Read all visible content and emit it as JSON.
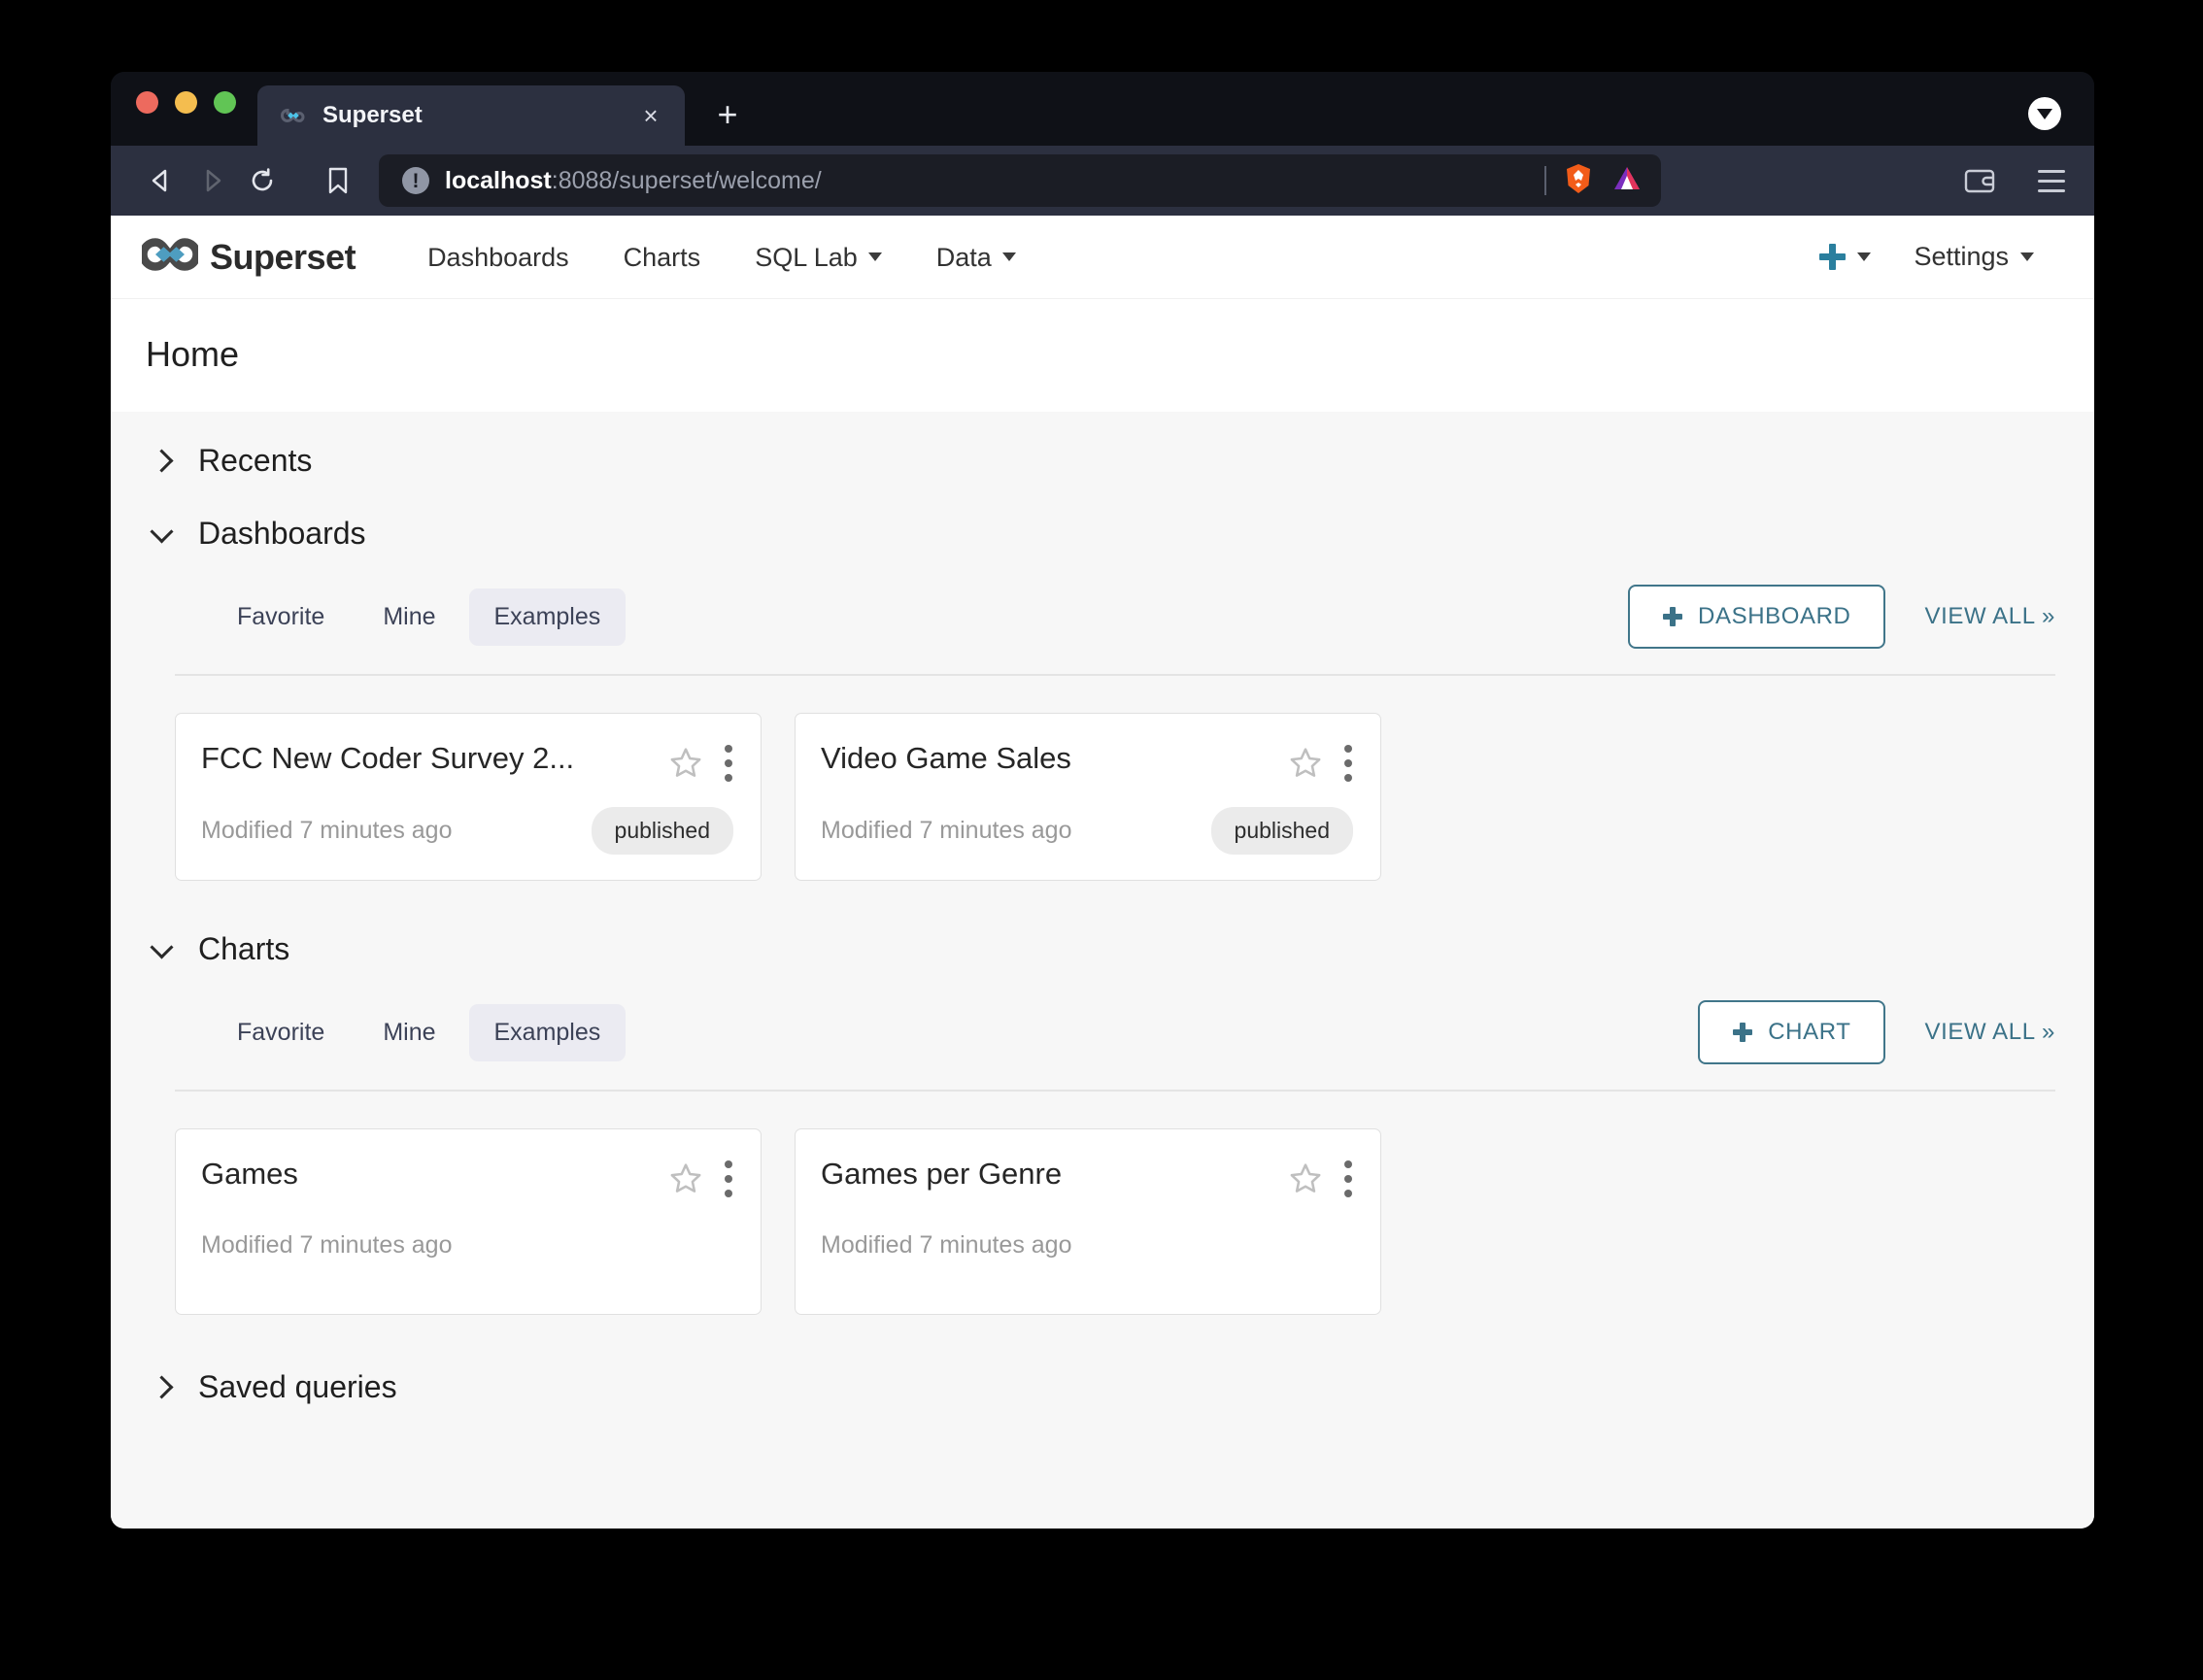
{
  "browser": {
    "tab": {
      "title": "Superset",
      "favicon": "superset-infinity-icon",
      "close_label": "×"
    },
    "new_tab_label": "+",
    "url": {
      "host": "localhost",
      "rest": ":8088/superset/welcome/"
    },
    "icons": {
      "back": "back-arrow-icon",
      "forward": "forward-arrow-icon",
      "reload": "reload-icon",
      "bookmark": "bookmark-icon",
      "shields": "brave-lion-icon",
      "rewards": "brave-bat-triangle-icon",
      "wallet": "wallet-icon",
      "menu": "hamburger-menu-icon",
      "tabstrip_down": "chevron-down-badge-icon"
    }
  },
  "navbar": {
    "brand": "Superset",
    "links": [
      {
        "label": "Dashboards",
        "has_caret": false
      },
      {
        "label": "Charts",
        "has_caret": false
      },
      {
        "label": "SQL Lab",
        "has_caret": true
      },
      {
        "label": "Data",
        "has_caret": true
      }
    ],
    "new_label": "",
    "settings_label": "Settings"
  },
  "page": {
    "title": "Home"
  },
  "sections": {
    "recents": {
      "label": "Recents",
      "expanded": false
    },
    "dashboards": {
      "label": "Dashboards",
      "expanded": true,
      "tabs": [
        {
          "label": "Favorite",
          "active": false
        },
        {
          "label": "Mine",
          "active": false
        },
        {
          "label": "Examples",
          "active": true
        }
      ],
      "add_button": "DASHBOARD",
      "view_all": "VIEW ALL »",
      "cards": [
        {
          "title": "FCC New Coder Survey 2...",
          "meta": "Modified 7 minutes ago",
          "badge": "published"
        },
        {
          "title": "Video Game Sales",
          "meta": "Modified 7 minutes ago",
          "badge": "published"
        }
      ]
    },
    "charts": {
      "label": "Charts",
      "expanded": true,
      "tabs": [
        {
          "label": "Favorite",
          "active": false
        },
        {
          "label": "Mine",
          "active": false
        },
        {
          "label": "Examples",
          "active": true
        }
      ],
      "add_button": "CHART",
      "view_all": "VIEW ALL »",
      "cards": [
        {
          "title": "Games",
          "meta": "Modified 7 minutes ago",
          "badge": ""
        },
        {
          "title": "Games per Genre",
          "meta": "Modified 7 minutes ago",
          "badge": ""
        }
      ]
    },
    "saved_queries": {
      "label": "Saved queries",
      "expanded": false
    }
  },
  "colors": {
    "accent_teal": "#3b7288",
    "plus_blue": "#2a7f9e",
    "logo_blue": "#4e9dc0",
    "page_bg": "#f7f7f7",
    "badge_bg": "#ebebeb"
  }
}
